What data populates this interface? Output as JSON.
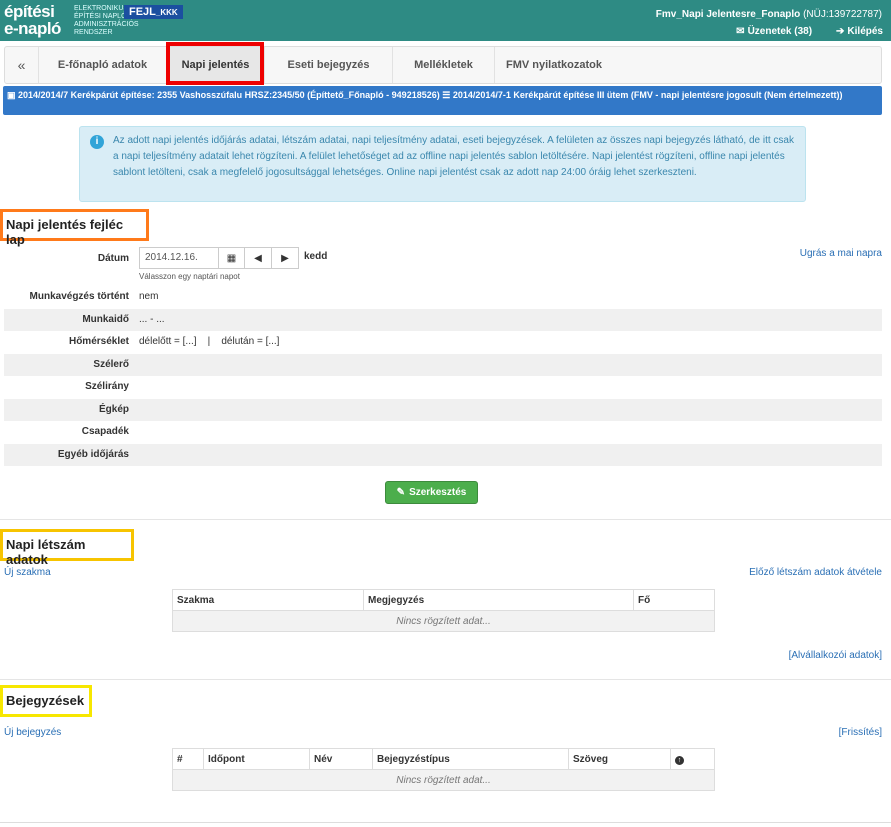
{
  "app": {
    "logo_line1": "építési",
    "logo_line2": "e-napló",
    "logo_sub": [
      "ELEKTRONIKUS",
      "ÉPÍTÉSI NAPLÓ",
      "ADMINISZTRÁCIÓS",
      "RENDSZER"
    ],
    "badge_main": "FEJL",
    "badge_sub": "_KKK",
    "user": "Fmv_Napi Jelentesre_Fonaplo",
    "user_id": "(NÜJ:139722787)",
    "messages": "Üzenetek (38)",
    "logout": "Kilépés"
  },
  "tabs": {
    "back": "«",
    "items": [
      "E-főnapló adatok",
      "Napi jelentés",
      "Eseti bejegyzés",
      "Mellékletek",
      "FMV nyilatkozatok"
    ]
  },
  "project": {
    "main": "2014/2014/7 Kerékpárút építése: 2355 Vashosszúfalu HRSZ:2345/50 (Építtető_Főnapló - 949218526)",
    "sub": "2014/2014/7-1 Kerékpárút építése III ütem (FMV - napi jelentésre jogosult (Nem értelmezett))"
  },
  "info": {
    "text": "Az adott napi jelentés időjárás adatai, létszám adatai, napi teljesítmény adatai, eseti bejegyzések. A felületen az összes napi bejegyzés látható, de itt csak a napi teljesítmény adatait lehet rögzíteni. A felület lehetőséget ad az offline napi jelentés sablon letöltésére. Napi jelentést rögzíteni, offline napi jelentés sablont letölteni, csak a megfelelő jogosultsággal lehetséges. Online napi jelentést csak az adott nap 24:00 óráig lehet szerkeszteni."
  },
  "header_section": {
    "title": "Napi jelentés fejléc lap",
    "date_label": "Dátum",
    "date_value": "2014.12.16.",
    "weekday": "kedd",
    "date_hint": "Válasszon egy naptári napot",
    "today_link": "Ugrás a mai napra",
    "rows": [
      {
        "label": "Munkavégzés történt",
        "value": "nem"
      },
      {
        "label": "Munkaidő",
        "value": "... - ..."
      },
      {
        "label": "Hőmérséklet",
        "value": "délelőtt = [...]    |    délután = [...]"
      },
      {
        "label": "Szélerő",
        "value": ""
      },
      {
        "label": "Szélirány",
        "value": ""
      },
      {
        "label": "Égkép",
        "value": ""
      },
      {
        "label": "Csapadék",
        "value": ""
      },
      {
        "label": "Egyéb időjárás",
        "value": ""
      }
    ],
    "edit_button": "Szerkesztés"
  },
  "staff_section": {
    "title": "Napi létszám adatok",
    "new_link": "Új szakma",
    "prev_link": "Előző létszám adatok átvétele",
    "columns": [
      "Szakma",
      "Megjegyzés",
      "Fő"
    ],
    "empty": "Nincs rögzített adat...",
    "sub_link": "[Alvállalkozói adatok]"
  },
  "entries_section": {
    "title": "Bejegyzések",
    "new_link": "Új bejegyzés",
    "refresh_link": "[Frissítés]",
    "columns": [
      "#",
      "Időpont",
      "Név",
      "Bejegyzéstípus",
      "Szöveg",
      "↑"
    ],
    "empty": "Nincs rögzített adat..."
  }
}
